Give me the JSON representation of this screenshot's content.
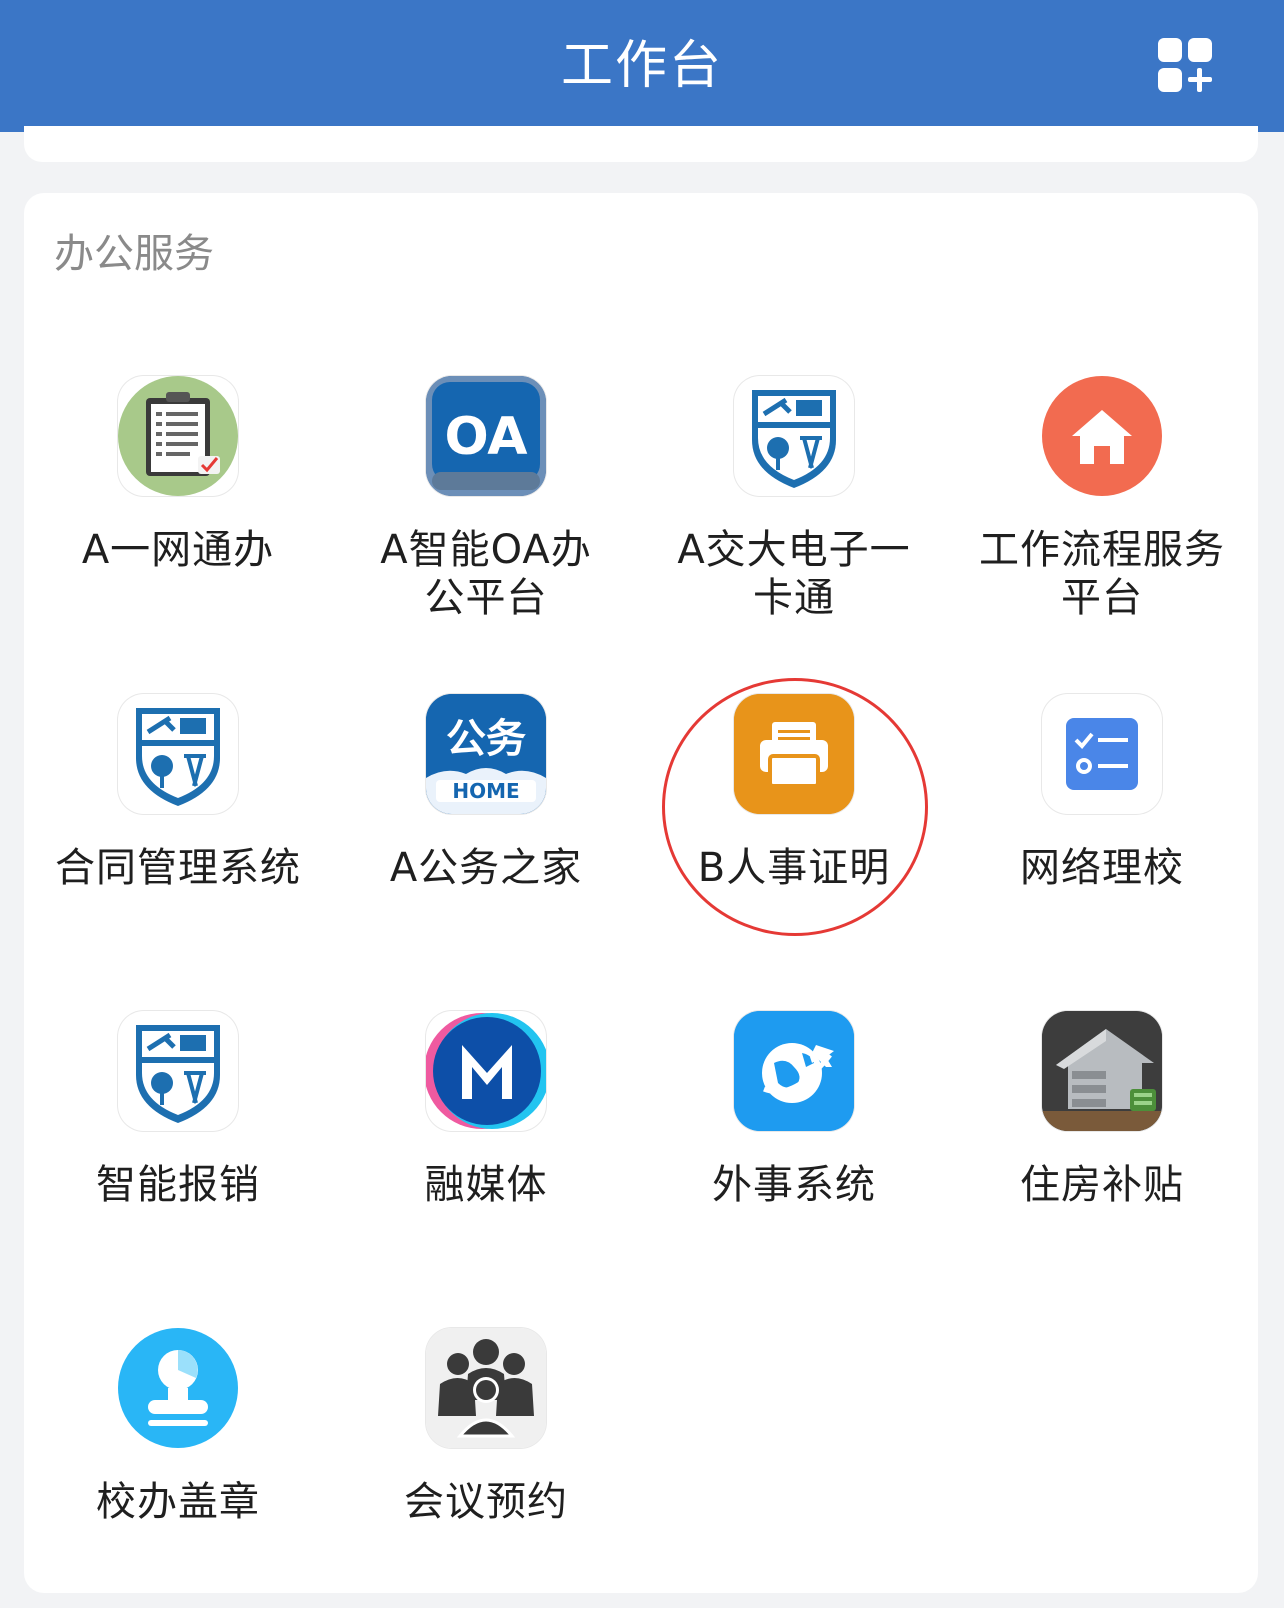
{
  "header": {
    "title": "工作台"
  },
  "section": {
    "title": "办公服务"
  },
  "apps": [
    {
      "label": "A一网通办",
      "icon": "clipboard-checklist-icon"
    },
    {
      "label": "A智能OA办公平台",
      "icon": "oa-icon"
    },
    {
      "label": "A交大电子一卡通",
      "icon": "university-shield-icon"
    },
    {
      "label": "工作流程服务平台",
      "icon": "home-icon"
    },
    {
      "label": "合同管理系统",
      "icon": "university-shield-icon"
    },
    {
      "label": "A公务之家",
      "icon": "gongwu-home-icon"
    },
    {
      "label": "B人事证明",
      "icon": "printer-icon"
    },
    {
      "label": "网络理校",
      "icon": "checklist-icon"
    },
    {
      "label": "智能报销",
      "icon": "university-shield-icon"
    },
    {
      "label": "融媒体",
      "icon": "m-logo-icon"
    },
    {
      "label": "外事系统",
      "icon": "globe-plane-icon"
    },
    {
      "label": "住房补贴",
      "icon": "house-money-icon"
    },
    {
      "label": "校办盖章",
      "icon": "stamp-icon"
    },
    {
      "label": "会议预约",
      "icon": "people-group-icon"
    }
  ],
  "icon_text": {
    "oa": "OA",
    "gongwu": "公务",
    "home": "HOME"
  },
  "colors": {
    "header_bg": "#3b76c6",
    "highlight_ring": "#e53935",
    "printer_bg": "#e8941a",
    "home_bg": "#f26b50",
    "checklist_bg": "#4a86e8",
    "globe_bg": "#1e9bf0",
    "stamp_bg": "#29b6f6"
  }
}
